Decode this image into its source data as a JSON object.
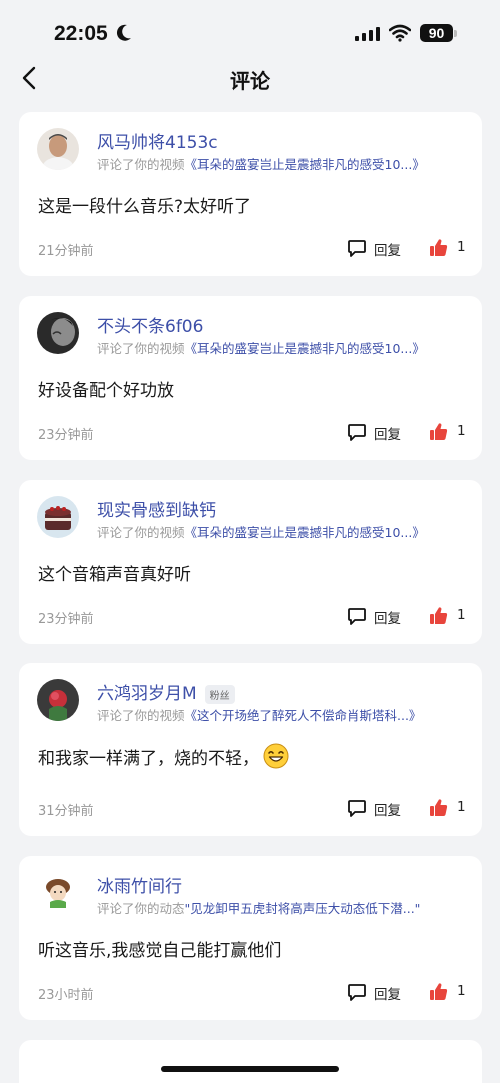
{
  "status": {
    "time": "22:05",
    "battery": "90"
  },
  "nav": {
    "title": "评论"
  },
  "comments": [
    {
      "username": "风马帅将4153c",
      "fan_badge": "",
      "action": "评论了你的视频",
      "target": "《耳朵的盛宴岂止是震撼非凡的感受10...》",
      "text": "这是一段什么音乐?太好听了",
      "time": "21分钟前",
      "reply_label": "回复",
      "likes": "1"
    },
    {
      "username": "不头不条6f06",
      "fan_badge": "",
      "action": "评论了你的视频",
      "target": "《耳朵的盛宴岂止是震撼非凡的感受10...》",
      "text": "好设备配个好功放",
      "time": "23分钟前",
      "reply_label": "回复",
      "likes": "1"
    },
    {
      "username": "现实骨感到缺钙",
      "fan_badge": "",
      "action": "评论了你的视频",
      "target": "《耳朵的盛宴岂止是震撼非凡的感受10...》",
      "text": "这个音箱声音真好听",
      "time": "23分钟前",
      "reply_label": "回复",
      "likes": "1"
    },
    {
      "username": "六鸿羽岁月M",
      "fan_badge": "粉丝",
      "action": "评论了你的视频",
      "target": "《这个开场绝了醉死人不偿命肖斯塔科...》",
      "text": "和我家一样满了，烧的不轻，",
      "time": "31分钟前",
      "reply_label": "回复",
      "likes": "1"
    },
    {
      "username": "冰雨竹间行",
      "fan_badge": "",
      "action": "评论了你的动态",
      "target": "\"见龙卸甲五虎封将高声压大动态低下潜...\"",
      "text": "听这音乐,我感觉自己能打赢他们",
      "time": "23小时前",
      "reply_label": "回复",
      "likes": "1"
    }
  ],
  "colors": {
    "link": "#3d4fa8",
    "like": "#e8453c",
    "background": "#f2f3f5"
  }
}
